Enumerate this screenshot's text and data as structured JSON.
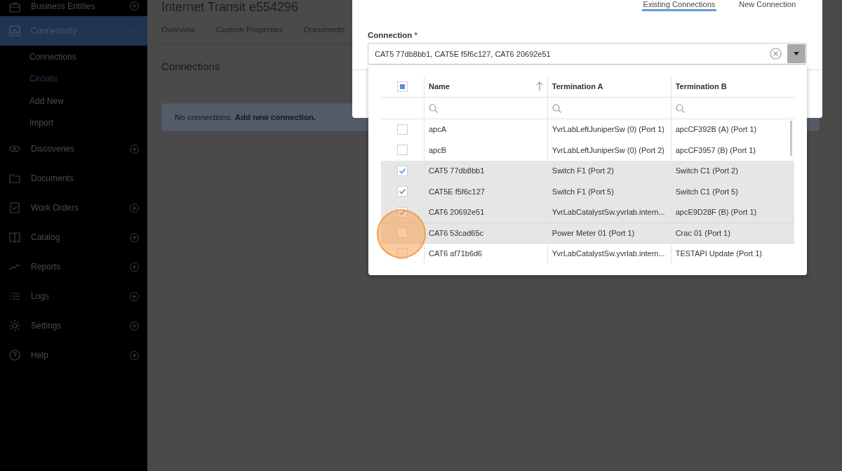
{
  "sidebar": {
    "items": [
      {
        "label": "Business Entities",
        "expandable": true,
        "expanded": false,
        "selected": false
      },
      {
        "label": "Connectivity",
        "expandable": true,
        "expanded": true,
        "selected": true,
        "children": [
          {
            "label": "Connections",
            "selected": false
          },
          {
            "label": "Circuits",
            "selected": true
          },
          {
            "label": "Add New",
            "selected": false
          },
          {
            "label": "Import",
            "selected": false
          }
        ]
      },
      {
        "label": "Discoveries",
        "expandable": true,
        "expanded": false,
        "selected": false
      },
      {
        "label": "Documents",
        "expandable": false,
        "selected": false
      },
      {
        "label": "Work Orders",
        "expandable": true,
        "expanded": false,
        "selected": false
      },
      {
        "label": "Catalog",
        "expandable": true,
        "expanded": false,
        "selected": false
      },
      {
        "label": "Reports",
        "expandable": true,
        "expanded": false,
        "selected": false
      },
      {
        "label": "Logs",
        "expandable": true,
        "expanded": false,
        "selected": false
      },
      {
        "label": "Settings",
        "expandable": true,
        "expanded": false,
        "selected": false
      },
      {
        "label": "Help",
        "expandable": true,
        "expanded": false,
        "selected": false
      }
    ]
  },
  "page": {
    "title": "Internet Transit e554296",
    "tabs": [
      {
        "label": "Overview",
        "selected": false
      },
      {
        "label": "Custom Properties",
        "selected": false
      },
      {
        "label": "Documents",
        "selected": false
      }
    ],
    "section_title": "Connections",
    "notice": "No connections. **Add new connection.**"
  },
  "dialog": {
    "tabs": [
      {
        "label": "Existing Connections",
        "selected": true
      },
      {
        "label": "New Connection",
        "selected": false
      }
    ],
    "field_label": "Connection",
    "required_mark": "*",
    "value": "CAT5 77db8bb1, CAT5E f5f6c127, CAT6 20692e51",
    "dropdown": {
      "select_all": {
        "indeterminate": true
      },
      "columns": [
        {
          "label": "Name",
          "sorted": true
        },
        {
          "label": "Termination A",
          "sorted": false
        },
        {
          "label": "Termination B",
          "sorted": false
        }
      ],
      "rows": [
        {
          "name": "apcA",
          "termination_a": "YvrLabLeftJuniperSw (0) (Port 1)",
          "termination_b": "apcCF392B (A) (Port 1)",
          "checked": false,
          "hovered": false
        },
        {
          "name": "apcB",
          "termination_a": "YvrLabLeftJuniperSw (0) (Port 2)",
          "termination_b": "apcCF3957 (B) (Port 1)",
          "checked": false,
          "hovered": false
        },
        {
          "name": "CAT5 77db8bb1",
          "termination_a": "Switch F1 (Port 2)",
          "termination_b": "Switch C1 (Port 2)",
          "checked": true,
          "hovered": false
        },
        {
          "name": "CAT5E f5f6c127",
          "termination_a": "Switch F1 (Port 5)",
          "termination_b": "Switch C1 (Port 5)",
          "checked": true,
          "hovered": false
        },
        {
          "name": "CAT6 20692e51",
          "termination_a": "YvrLabCatalystSw.yvrlab.intern...",
          "termination_b": "apcE9D28F (B) (Port 1)",
          "checked": true,
          "hovered": false
        },
        {
          "name": "CAT6 53cad65c",
          "termination_a": "Power Meter 01 (Port 1)",
          "termination_b": "Crac 01 (Port 1)",
          "checked": false,
          "hovered": true
        },
        {
          "name": "CAT6 af71b6d6",
          "termination_a": "YvrLabCatalystSw.yvrlab.intern...",
          "termination_b": "TESTAPI Update (Port 1)",
          "checked": false,
          "hovered": false
        }
      ]
    }
  }
}
